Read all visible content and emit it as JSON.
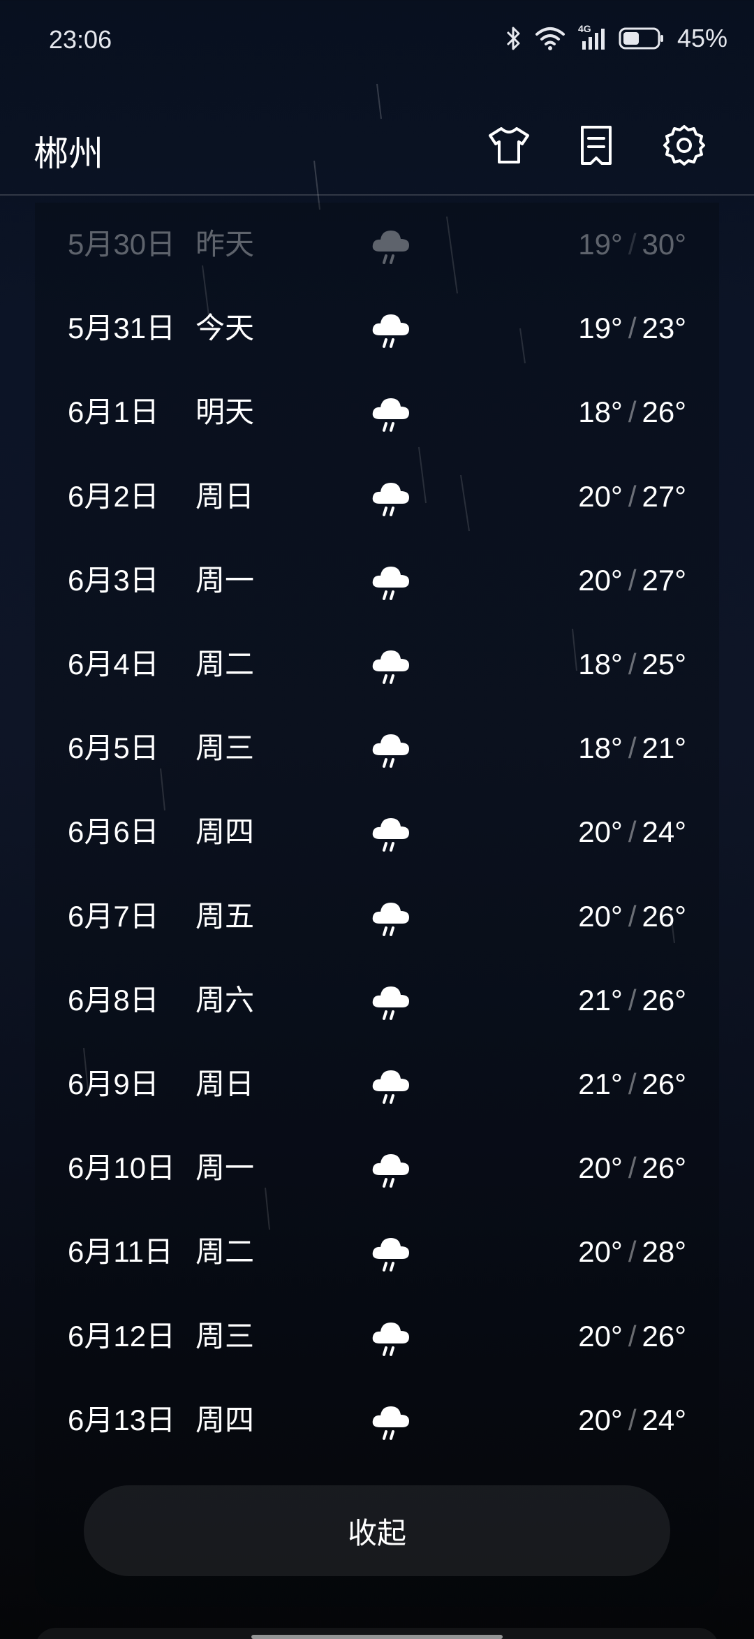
{
  "status_bar": {
    "time": "23:06",
    "network": "4G",
    "battery": "45%",
    "icons": [
      "bluetooth-icon",
      "wifi-icon",
      "signal-icon",
      "battery-icon"
    ]
  },
  "header": {
    "city": "郴州",
    "icons": [
      "clothing-icon",
      "report-icon",
      "settings-icon"
    ]
  },
  "forecast": [
    {
      "date": "5月30日",
      "day": "昨天",
      "weather_icon": "rain-cloud-icon",
      "low": "19°",
      "high": "30°",
      "past": true
    },
    {
      "date": "5月31日",
      "day": "今天",
      "weather_icon": "rain-cloud-icon",
      "low": "19°",
      "high": "23°",
      "past": false
    },
    {
      "date": "6月1日",
      "day": "明天",
      "weather_icon": "rain-cloud-icon",
      "low": "18°",
      "high": "26°",
      "past": false
    },
    {
      "date": "6月2日",
      "day": "周日",
      "weather_icon": "rain-cloud-icon",
      "low": "20°",
      "high": "27°",
      "past": false
    },
    {
      "date": "6月3日",
      "day": "周一",
      "weather_icon": "rain-cloud-icon",
      "low": "20°",
      "high": "27°",
      "past": false
    },
    {
      "date": "6月4日",
      "day": "周二",
      "weather_icon": "rain-cloud-icon",
      "low": "18°",
      "high": "25°",
      "past": false
    },
    {
      "date": "6月5日",
      "day": "周三",
      "weather_icon": "rain-cloud-icon",
      "low": "18°",
      "high": "21°",
      "past": false
    },
    {
      "date": "6月6日",
      "day": "周四",
      "weather_icon": "rain-cloud-icon",
      "low": "20°",
      "high": "24°",
      "past": false
    },
    {
      "date": "6月7日",
      "day": "周五",
      "weather_icon": "rain-cloud-icon",
      "low": "20°",
      "high": "26°",
      "past": false
    },
    {
      "date": "6月8日",
      "day": "周六",
      "weather_icon": "rain-cloud-icon",
      "low": "21°",
      "high": "26°",
      "past": false
    },
    {
      "date": "6月9日",
      "day": "周日",
      "weather_icon": "rain-cloud-icon",
      "low": "21°",
      "high": "26°",
      "past": false
    },
    {
      "date": "6月10日",
      "day": "周一",
      "weather_icon": "rain-cloud-icon",
      "low": "20°",
      "high": "26°",
      "past": false
    },
    {
      "date": "6月11日",
      "day": "周二",
      "weather_icon": "rain-cloud-icon",
      "low": "20°",
      "high": "28°",
      "past": false
    },
    {
      "date": "6月12日",
      "day": "周三",
      "weather_icon": "rain-cloud-icon",
      "low": "20°",
      "high": "26°",
      "past": false
    },
    {
      "date": "6月13日",
      "day": "周四",
      "weather_icon": "rain-cloud-icon",
      "low": "20°",
      "high": "24°",
      "past": false
    }
  ],
  "separator": "/",
  "collapse_label": "收起",
  "colors": {
    "background_top": "#08101f",
    "background_bottom": "#050608",
    "text": "#ffffff"
  }
}
